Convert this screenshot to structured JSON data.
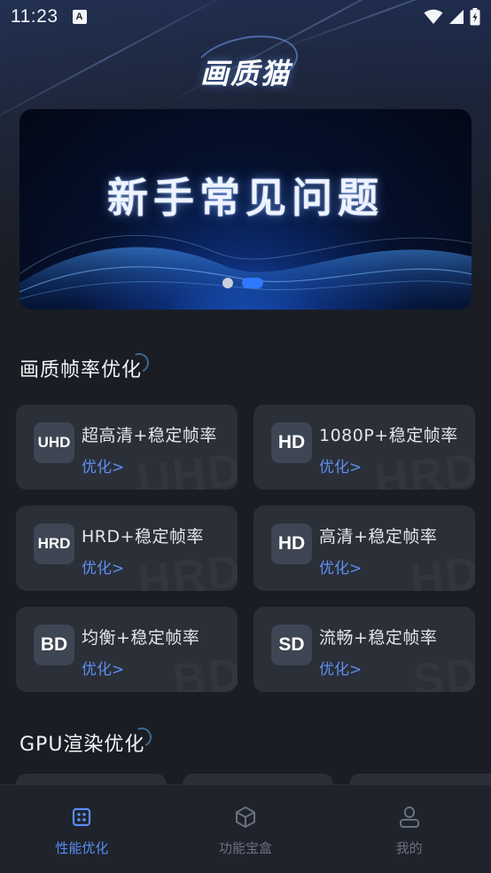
{
  "status_bar": {
    "time": "11:23",
    "notification_glyph": "A"
  },
  "app": {
    "logo_text": "画质猫"
  },
  "banner": {
    "title": "新手常见问题",
    "slide_count": 2,
    "active_slide": 2
  },
  "sections": {
    "frame_rate": {
      "title": "画质帧率优化",
      "cards": [
        {
          "badge": "UHD",
          "title": "超高清+稳定帧率",
          "action": "优化>",
          "watermark": "UHD"
        },
        {
          "badge": "HD",
          "title": "1080P+稳定帧率",
          "action": "优化>",
          "watermark": "HRD"
        },
        {
          "badge": "HRD",
          "title": "HRD+稳定帧率",
          "action": "优化>",
          "watermark": "HRD"
        },
        {
          "badge": "HD",
          "title": "高清+稳定帧率",
          "action": "优化>",
          "watermark": "HD"
        },
        {
          "badge": "BD",
          "title": "均衡+稳定帧率",
          "action": "优化>",
          "watermark": "BD"
        },
        {
          "badge": "SD",
          "title": "流畅+稳定帧率",
          "action": "优化>",
          "watermark": "SD"
        }
      ]
    },
    "gpu": {
      "title": "GPU渲染优化"
    }
  },
  "bottom_nav": {
    "items": [
      {
        "label": "性能优化",
        "icon": "dice-icon",
        "active": true
      },
      {
        "label": "功能宝盒",
        "icon": "cube-box-icon",
        "active": false
      },
      {
        "label": "我的",
        "icon": "person-icon",
        "active": false
      }
    ]
  },
  "colors": {
    "background": "#1a1d24",
    "card": "#2a2f38",
    "accent": "#5b8ef5",
    "inactive": "#6b717d"
  }
}
